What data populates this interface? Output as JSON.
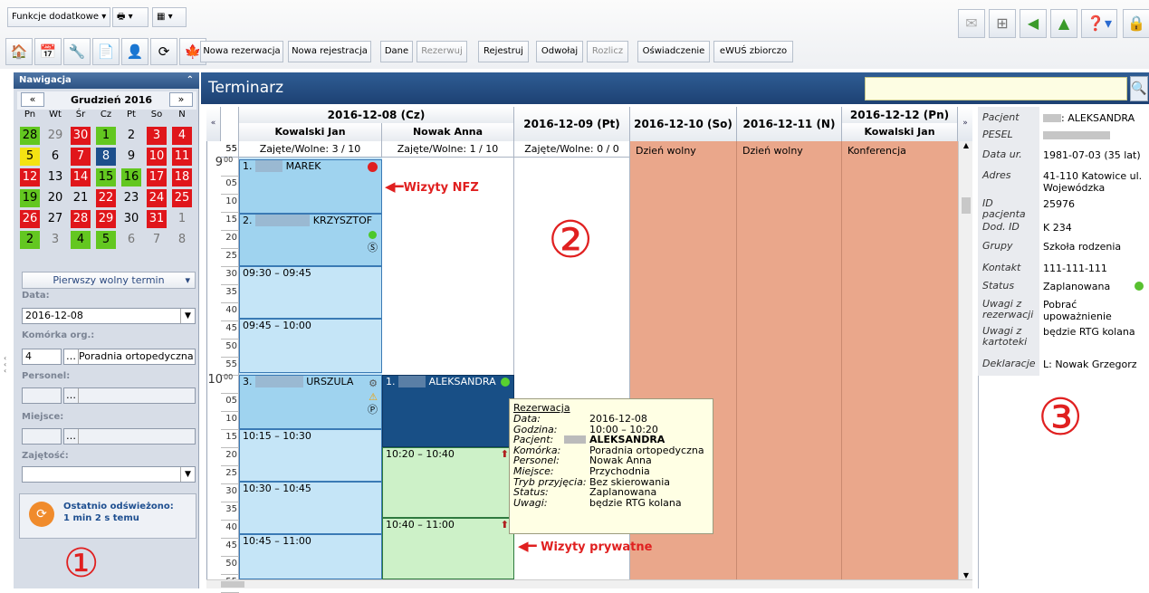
{
  "toolbar": {
    "funkcje": "Funkcje dodatkowe",
    "buttons": [
      "Nowa rezerwacja",
      "Nowa rejestracja",
      "Dane",
      "Rezerwuj",
      "Rejestruj",
      "Odwołaj",
      "Rozlicz",
      "Oświadczenie",
      "eWUŚ zbiorczo"
    ]
  },
  "nav": {
    "title": "Nawigacja",
    "month": "Grudzień 2016",
    "prev": "«",
    "next": "»",
    "weekdays": [
      "Pn",
      "Wt",
      "Śr",
      "Cz",
      "Pt",
      "So",
      "N"
    ],
    "days": [
      [
        "28",
        "g"
      ],
      [
        "29",
        "n"
      ],
      [
        "30",
        "r"
      ],
      [
        "1",
        "g"
      ],
      [
        "2",
        "w"
      ],
      [
        "3",
        "r"
      ],
      [
        "4",
        "r"
      ],
      [
        "5",
        "y"
      ],
      [
        "6",
        "w"
      ],
      [
        "7",
        "r"
      ],
      [
        "8",
        "b"
      ],
      [
        "9",
        "w"
      ],
      [
        "10",
        "r"
      ],
      [
        "11",
        "r"
      ],
      [
        "12",
        "r"
      ],
      [
        "13",
        "w"
      ],
      [
        "14",
        "r"
      ],
      [
        "15",
        "g"
      ],
      [
        "16",
        "g"
      ],
      [
        "17",
        "r"
      ],
      [
        "18",
        "r"
      ],
      [
        "19",
        "g"
      ],
      [
        "20",
        "w"
      ],
      [
        "21",
        "w"
      ],
      [
        "22",
        "r"
      ],
      [
        "23",
        "w"
      ],
      [
        "24",
        "r"
      ],
      [
        "25",
        "r"
      ],
      [
        "26",
        "r"
      ],
      [
        "27",
        "w"
      ],
      [
        "28",
        "r"
      ],
      [
        "29",
        "r"
      ],
      [
        "30",
        "w"
      ],
      [
        "31",
        "r"
      ],
      [
        "1",
        "n"
      ],
      [
        "2",
        "g"
      ],
      [
        "3",
        "n"
      ],
      [
        "4",
        "g"
      ],
      [
        "5",
        "g"
      ],
      [
        "6",
        "n"
      ],
      [
        "7",
        "n"
      ],
      [
        "8",
        "n"
      ]
    ],
    "first_free": "Pierwszy wolny termin",
    "data_label": "Data:",
    "data_value": "2016-12-08",
    "kom_label": "Komórka org.:",
    "kom_code": "4",
    "kom_name": "Poradnia ortopedyczna",
    "personel_label": "Personel:",
    "miejsce_label": "Miejsce:",
    "zajetosc_label": "Zajętość:",
    "refresh1": "Ostatnio odświeżono:",
    "refresh2": "1 min 2 s temu",
    "badge": "①"
  },
  "main": {
    "title": "Terminarz",
    "nav_prev": "«",
    "nav_next": "»",
    "cols": [
      {
        "date": "2016-12-08 (Cz)",
        "people": [
          "Kowalski Jan",
          "Nowak Anna"
        ],
        "stats": [
          "Zajęte/Wolne: 3 / 10",
          "Zajęte/Wolne: 1 / 10"
        ]
      },
      {
        "date": "2016-12-09 (Pt)",
        "stat": "Zajęte/Wolne: 0 / 0"
      },
      {
        "date": "2016-12-10 (So)",
        "note": "Dzień wolny"
      },
      {
        "date": "2016-12-11 (N)",
        "note": "Dzień wolny"
      },
      {
        "date": "2016-12-12 (Pn)",
        "person": "Kowalski Jan",
        "note": "Konferencja"
      }
    ],
    "hours": [
      "9",
      "10"
    ],
    "minutes": [
      "00",
      "05",
      "10",
      "15",
      "20",
      "25",
      "30",
      "35",
      "40",
      "45",
      "50",
      "55"
    ],
    "top_min": "55",
    "sup": "00",
    "appts": {
      "a1": "1.",
      "a1n": "MAREK",
      "a2": "2.",
      "a2n": "KRZYSZTOF",
      "s1": "09:30 – 09:45",
      "s2": "09:45 – 10:00",
      "a3": "3.",
      "a3n": "URSZULA",
      "s3": "10:15 – 10:30",
      "s4": "10:30 – 10:45",
      "s5": "10:45 – 11:00",
      "b1": "1.",
      "b1n": "ALEKSANDRA",
      "b2": "10:20 – 10:40",
      "b3": "10:40 – 11:00"
    },
    "ann_nfz": "Wizyty NFZ",
    "ann_pryw": "Wizyty prywatne",
    "badge2": "②"
  },
  "tip": {
    "title": "Rezerwacja",
    "rows": [
      [
        "Data:",
        "2016-12-08"
      ],
      [
        "Godzina:",
        "10:00 – 10:20"
      ],
      [
        "Pacjent:",
        "ALEKSANDRA"
      ],
      [
        "Komórka:",
        "Poradnia ortopedyczna"
      ],
      [
        "Personel:",
        "Nowak Anna"
      ],
      [
        "Miejsce:",
        "Przychodnia"
      ],
      [
        "Tryb przyjęcia:",
        "Bez skierowania"
      ],
      [
        "Status:",
        "Zaplanowana"
      ],
      [
        "Uwagi:",
        "będzie RTG kolana"
      ]
    ]
  },
  "patient": {
    "rows": [
      [
        "Pacjent",
        ": ALEKSANDRA"
      ],
      [
        "PESEL",
        ""
      ],
      [
        "Data ur.",
        "1981-07-03 (35 lat)"
      ],
      [
        "Adres",
        "41-110 Katowice ul. Wojewódzka"
      ],
      [
        "ID pacjenta",
        "25976"
      ],
      [
        "Dod. ID",
        "K 234"
      ],
      [
        "Grupy",
        "Szkoła rodzenia"
      ],
      [
        "Kontakt",
        "111-111-111"
      ],
      [
        "Status",
        "Zaplanowana"
      ],
      [
        "Uwagi z rezerwacji",
        "Pobrać upoważnienie"
      ],
      [
        "Uwagi z kartoteki",
        "będzie RTG kolana"
      ],
      [
        "Deklaracje",
        "L: Nowak Grzegorz"
      ]
    ],
    "badge3": "③"
  },
  "colors": {
    "nfz": "#bfe2f6",
    "pryw": "#cdf1c8",
    "free": "#eaa78b",
    "annot": "#e02020"
  }
}
